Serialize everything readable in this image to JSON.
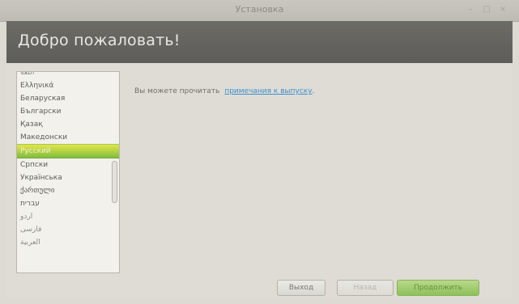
{
  "window": {
    "title": "Установка",
    "controls": [
      "minimize-icon",
      "maximize-icon",
      "close-icon"
    ]
  },
  "header": {
    "title": "Добро пожаловать!"
  },
  "languages": {
    "items": [
      {
        "label": "اللغة",
        "state": "partial"
      },
      {
        "label": "Ελληνικά"
      },
      {
        "label": "Беларуская"
      },
      {
        "label": "Български"
      },
      {
        "label": "Қазақ"
      },
      {
        "label": "Македонски"
      },
      {
        "label": "Русский",
        "selected": true
      },
      {
        "label": "Српски"
      },
      {
        "label": "Українська"
      },
      {
        "label": "ქართული"
      },
      {
        "label": "עברית"
      },
      {
        "label": "اردو"
      },
      {
        "label": "فارسی"
      },
      {
        "label": "ﺍﻟﻌﺮﺑﻴﺔ"
      }
    ],
    "selected": "Русский"
  },
  "notes": {
    "text": "Вы можете прочитать",
    "link": "примечания к выпуску",
    "suffix": "."
  },
  "buttons": {
    "quit": "Выход",
    "back": "Назад",
    "next": "Продолжить"
  },
  "colors": {
    "header_bg": "#646360",
    "link": "#3d8fd2",
    "selection": "#8ec15a"
  }
}
